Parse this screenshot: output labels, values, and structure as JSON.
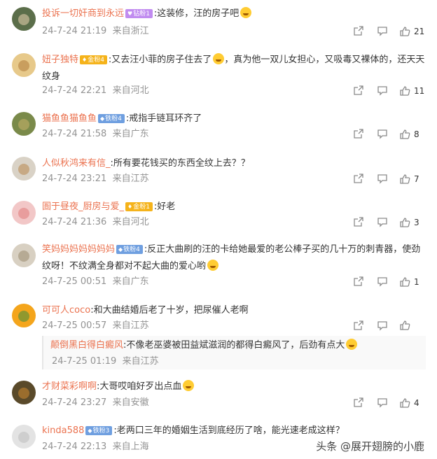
{
  "comments": [
    {
      "user": "投诉一切奸商到永远",
      "badge": "钻粉1",
      "text": ":这装修，汪的房子吧",
      "emoji": "laugh",
      "time": "24-7-24 21:19",
      "location": "来自浙江",
      "likes": "21"
    },
    {
      "user": "妞子独特",
      "badge": "金粉4",
      "text": ":又去汪小菲的房子住去了",
      "text2": "，真为他一双儿女担心，又吸毒又裸体的，还天天纹身",
      "emoji": "dizzy",
      "time": "24-7-24 22:21",
      "location": "来自河北",
      "likes": "11"
    },
    {
      "user": "猫鱼鱼猫鱼鱼",
      "badge": "铁粉4",
      "text": ":戒指手链耳环齐了",
      "time": "24-7-24 21:58",
      "location": "来自广东",
      "likes": "8"
    },
    {
      "user": "人似秋鸿来有信_",
      "text": ":所有要花钱买的东西全纹上去？？",
      "time": "24-7-24 23:21",
      "location": "来自江苏",
      "likes": "7"
    },
    {
      "user": "圄于昼夜_厨房与爱_",
      "badge": "金粉1",
      "text": ":好老",
      "time": "24-7-24 21:36",
      "location": "来自河北",
      "likes": "3"
    },
    {
      "user": "笑妈妈妈妈妈妈妈",
      "badge": "铁粉4",
      "text": ":反正大曲刷的汪的卡给她最爱的老公棒子买的几十万的刺青器，使劲纹呀！不纹满全身都对不起大曲的爱心哟",
      "emoji": "grin",
      "time": "24-7-25 00:51",
      "location": "来自广东",
      "likes": "1"
    },
    {
      "user": "可可人coco",
      "text": ":和大曲结婚后老了十岁，把尿催人老啊",
      "time": "24-7-25 00:57",
      "location": "来自江苏",
      "likes": ""
    },
    {
      "user": "才财菜彩啊啊",
      "text": ":大哥哎咱好歹出点血",
      "emoji": "smile",
      "time": "24-7-24 23:27",
      "location": "来自安徽",
      "likes": "4"
    },
    {
      "user": "kinda588",
      "badge": "铁粉3",
      "text": ":老两口三年的婚姻生活到底经历了啥，能光速老成这样？",
      "time": "24-7-24 22:13",
      "location": "来自上海",
      "likes": ""
    }
  ],
  "reply": {
    "user": "颠倒黑白得白癜风",
    "text": ":不像老巫婆被田益斌滋润的都得白癜风了，后劲有点大",
    "emoji": "dizzy",
    "time": "24-7-25 01:19",
    "location": "来自江苏"
  },
  "watermark": {
    "text": "头条 @展开翅膀的小鹿"
  },
  "colors": {
    "username": "#eb7350",
    "meta": "#939393",
    "badge_gold": "#f5b31b",
    "badge_blue": "#6f9fe0",
    "badge_purple": "#c18cf0"
  },
  "icons": {
    "share": "share-icon",
    "reply": "comment-icon",
    "like": "thumbs-up-icon"
  }
}
